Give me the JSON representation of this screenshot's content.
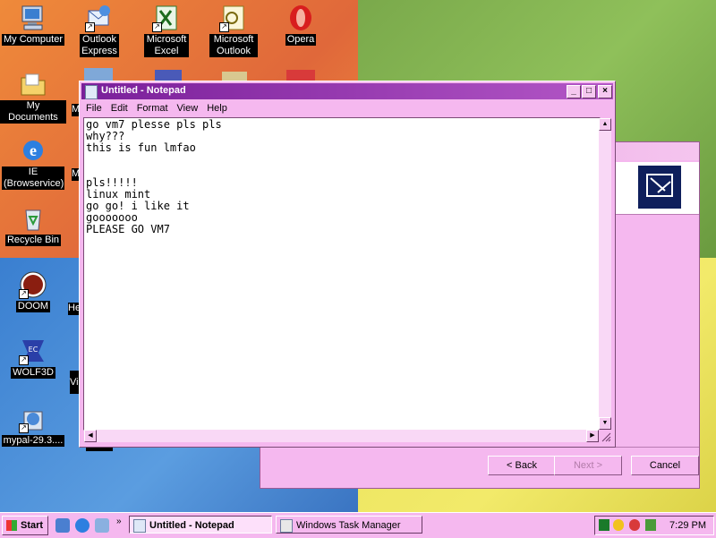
{
  "desktop": {
    "icons": [
      {
        "label": "My Computer"
      },
      {
        "label": "Outlook Express"
      },
      {
        "label": "Microsoft Excel"
      },
      {
        "label": "Microsoft Outlook"
      },
      {
        "label": "Opera"
      },
      {
        "label": "My Documents"
      },
      {
        "label": "IE (Browservice)"
      },
      {
        "label": "Recycle Bin"
      },
      {
        "label": "DOOM"
      },
      {
        "label": "WOLF3D"
      },
      {
        "label": "mypal-29.3...."
      }
    ],
    "partial_labels": [
      "M",
      "M",
      "He",
      "Vi"
    ]
  },
  "wizard": {
    "back_label": "< Back",
    "next_label": "Next >",
    "cancel_label": "Cancel"
  },
  "notepad": {
    "title": "Untitled - Notepad",
    "menu": [
      "File",
      "Edit",
      "Format",
      "View",
      "Help"
    ],
    "text": "go vm7 plesse pls pls\nwhy???\nthis is fun lmfao\n\n\npls!!!!!\nlinux mint\ngo go! i like it\ngooooooo\nPLEASE GO VM7"
  },
  "taskbar": {
    "start_label": "Start",
    "tasks": [
      {
        "label": "Untitled - Notepad",
        "active": true
      },
      {
        "label": "Windows Task Manager",
        "active": false
      }
    ],
    "clock": "7:29 PM"
  },
  "colors": {
    "theme_pink": "#f5b8ef",
    "titlebar_purple": "#7a1f9a"
  }
}
